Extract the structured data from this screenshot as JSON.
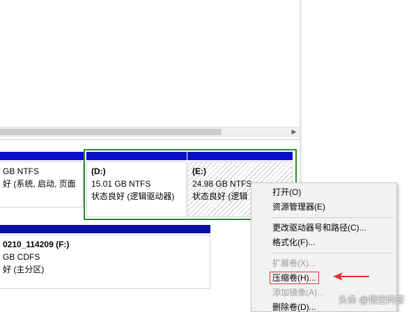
{
  "partitions": {
    "c": {
      "line1": "GB NTFS",
      "line2": "好 (系统, 启动, 页面"
    },
    "d": {
      "name": "(D:)",
      "line1": "15.01 GB NTFS",
      "line2": "状态良好 (逻辑驱动器)"
    },
    "e": {
      "name": "(E:)",
      "line1": "24.98 GB NTFS",
      "line2": "状态良好 (逻辑"
    },
    "f": {
      "name": "0210_114209  (F:)",
      "line1": "GB CDFS",
      "line2": "好 (主分区)"
    }
  },
  "context_menu": {
    "items": [
      {
        "label": "打开(O)",
        "enabled": true
      },
      {
        "label": "资源管理器(E)",
        "enabled": true
      },
      {
        "label": "更改驱动器号和路径(C)...",
        "enabled": true
      },
      {
        "label": "格式化(F)...",
        "enabled": true
      },
      {
        "label": "扩展卷(X)...",
        "enabled": false
      },
      {
        "label": "压缩卷(H)...",
        "enabled": true,
        "highlighted": true
      },
      {
        "label": "添加镜像(A)...",
        "enabled": false
      },
      {
        "label": "删除卷(D)...",
        "enabled": true
      }
    ]
  },
  "watermark": {
    "text": "头条 @悟空问答"
  },
  "colors": {
    "partition_bar": "#0a10c8",
    "selected_frame": "#2a8a2a",
    "annotation_red": "#e83030"
  }
}
